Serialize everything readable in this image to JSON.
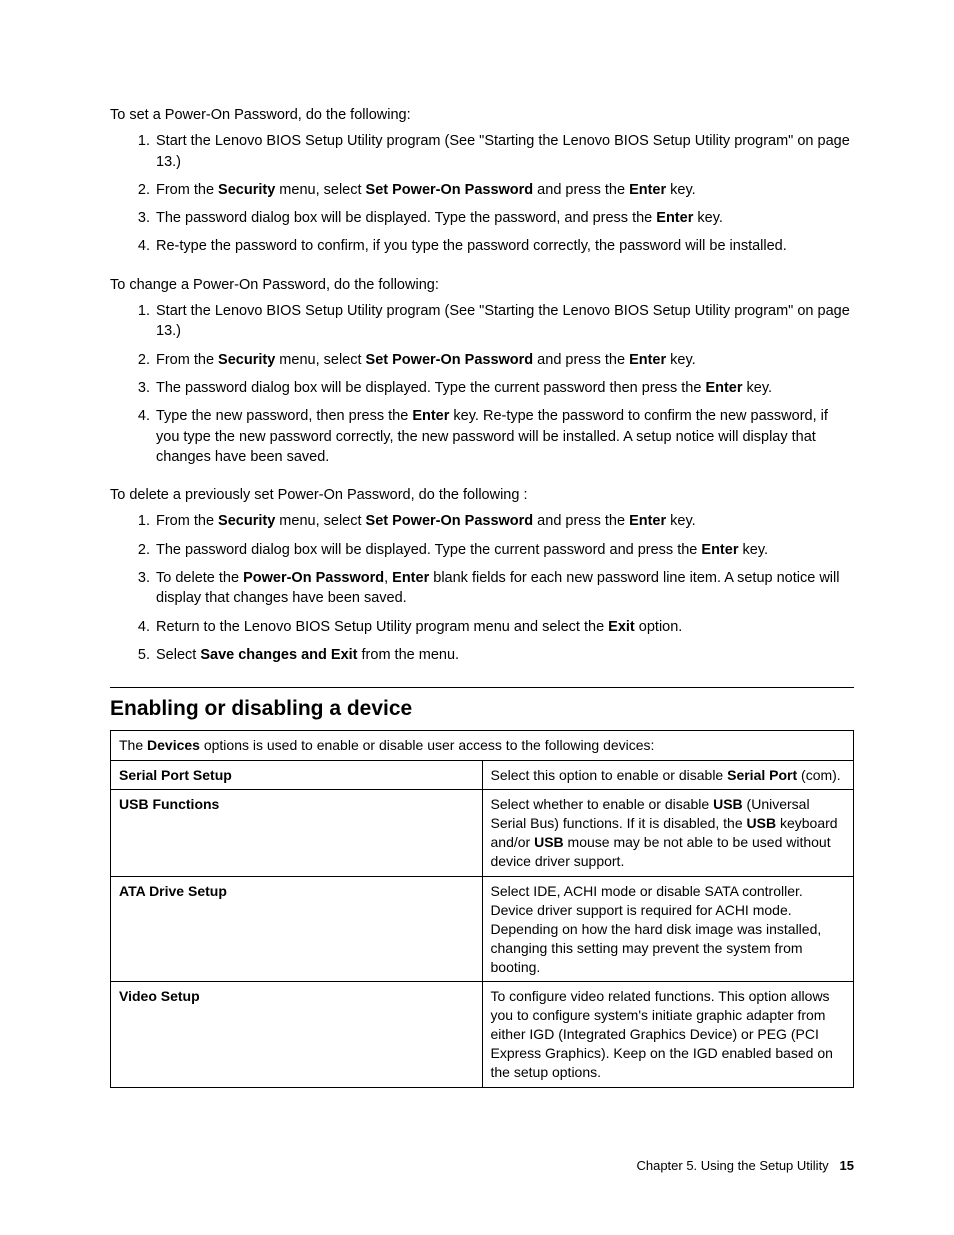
{
  "section1": {
    "intro": "To set a Power-On Password, do the following:",
    "items": [
      "Start the Lenovo BIOS Setup Utility program (See \"Starting the Lenovo BIOS Setup Utility program\" on page 13.)",
      {
        "t": "From the ",
        "b1": "Security",
        "t2": " menu, select ",
        "b2": "Set Power-On Password",
        "t3": " and press the ",
        "b3": "Enter",
        "t4": " key."
      },
      {
        "t": "The password dialog box will be displayed. Type the password, and press the ",
        "b1": "Enter",
        "t2": " key."
      },
      "Re-type the password to confirm, if you type the password correctly, the password will be installed."
    ]
  },
  "section2": {
    "intro": "To change a Power-On Password, do the following:",
    "items": [
      "Start the Lenovo BIOS Setup Utility program (See \"Starting the Lenovo BIOS Setup Utility program\" on page 13.)",
      {
        "t": "From the ",
        "b1": "Security",
        "t2": " menu, select ",
        "b2": "Set Power-On Password",
        "t3": " and press the ",
        "b3": "Enter",
        "t4": " key."
      },
      {
        "t": "The password dialog box will be displayed. Type the current password then press the ",
        "b1": "Enter",
        "t2": " key."
      },
      {
        "t": "Type the new password, then press the ",
        "b1": "Enter",
        "t2": " key. Re-type the password to confirm the new password, if you type the new password correctly, the new password will be installed. A setup notice will display that changes have been saved."
      }
    ]
  },
  "section3": {
    "intro": "To delete a previously set Power-On Password, do the following :",
    "items": [
      {
        "t": "From the ",
        "b1": "Security",
        "t2": " menu, select ",
        "b2": "Set Power-On Password",
        "t3": " and press the ",
        "b3": "Enter",
        "t4": " key."
      },
      {
        "t": "The password dialog box will be displayed. Type the current password and press the ",
        "b1": "Enter",
        "t2": " key."
      },
      {
        "t": "To delete the ",
        "b1": "Power-On Password",
        "t2": ", ",
        "b2": "Enter",
        "t3": " blank fields for each new password line item. A setup notice will display that changes have been saved."
      },
      {
        "t": "Return to the Lenovo BIOS Setup Utility program menu and select the ",
        "b1": "Exit",
        "t2": " option."
      },
      {
        "t": "Select ",
        "b1": "Save changes and Exit",
        "t2": " from the menu."
      }
    ]
  },
  "heading": "Enabling or disabling a device",
  "table": {
    "header": {
      "pre": "The ",
      "bold": "Devices",
      "post": " options is used to enable or disable user access to the following devices:"
    },
    "rows": [
      {
        "left": "Serial Port Setup",
        "right": {
          "t": "Select this option to enable or disable ",
          "b1": "Serial Port",
          "t2": " (com)."
        }
      },
      {
        "left": "USB Functions",
        "right": {
          "t": "Select whether to enable or disable ",
          "b1": "USB",
          "t2": " (Universal Serial Bus) functions. If it is disabled, the ",
          "b2": "USB",
          "t3": " keyboard and/or ",
          "b3": "USB",
          "t4": " mouse may be not able to be used without device driver support."
        }
      },
      {
        "left": "ATA Drive Setup",
        "right": {
          "t": "Select IDE, ACHI mode or disable SATA controller. Device driver support is required for ACHI mode. Depending on how the hard disk image was installed, changing this setting may prevent the system from booting."
        }
      },
      {
        "left": "Video Setup",
        "right": {
          "t": "To configure video related functions. This option allows you to configure system's initiate graphic adapter from either IGD (Integrated Graphics Device) or PEG (PCI Express Graphics). Keep on the IGD enabled based on the setup options."
        }
      }
    ]
  },
  "footer": {
    "chapter": "Chapter 5. Using the Setup Utility",
    "page": "15"
  }
}
